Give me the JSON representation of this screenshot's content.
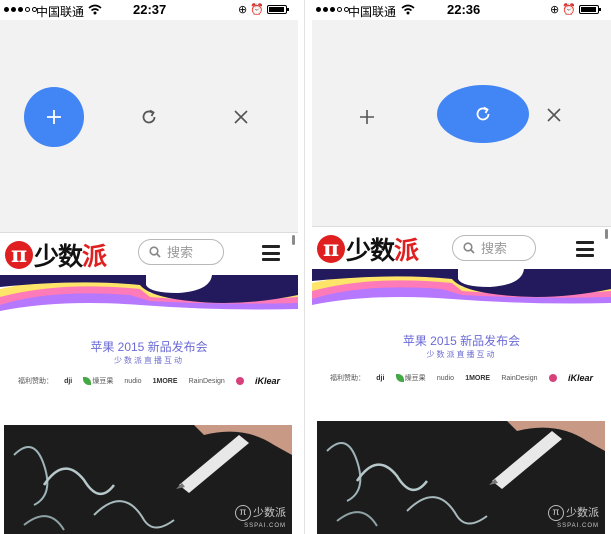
{
  "screens": [
    {
      "status": {
        "carrier": "中国联通",
        "time": "22:37"
      },
      "toolbar": {
        "highlighted": "add",
        "highlight_color": "#4285f4"
      },
      "webpage": {
        "logo_text": "少数派",
        "search_placeholder": "搜索",
        "event_title": "苹果 2015 新品发布会",
        "event_subtitle": "少数派直播互动",
        "sponsors": [
          "福利赞助：",
          "dji",
          "燥豆果",
          "nudio",
          "1MORE",
          "RainDesign",
          "iKlear"
        ],
        "watermark": {
          "name": "少数派",
          "domain": "SSPAI.COM"
        }
      }
    },
    {
      "status": {
        "carrier": "中国联通",
        "time": "22:36"
      },
      "toolbar": {
        "highlighted": "reload",
        "highlight_color": "#4285f4"
      },
      "webpage": {
        "logo_text": "少数派",
        "search_placeholder": "搜索",
        "event_title": "苹果 2015 新品发布会",
        "event_subtitle": "少数派直播互动",
        "sponsors": [
          "福利赞助：",
          "dji",
          "燥豆果",
          "nudio",
          "1MORE",
          "RainDesign",
          "iKlear"
        ],
        "watermark": {
          "name": "少数派",
          "domain": "SSPAI.COM"
        }
      }
    }
  ],
  "icons": [
    "plus-icon",
    "reload-icon",
    "close-icon",
    "search-icon",
    "menu-icon",
    "wifi-icon",
    "alarm-icon",
    "battery-icon"
  ],
  "colors": {
    "accent": "#4285f4",
    "brand_red": "#e02020",
    "toolbar_bg": "#f2f2f2"
  }
}
